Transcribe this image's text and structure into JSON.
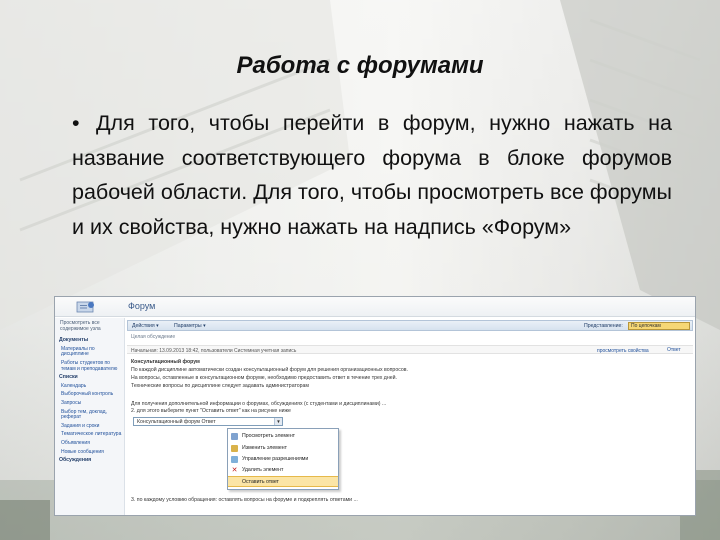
{
  "slide": {
    "title": "Работа с форумами",
    "bullet": "•",
    "text": "Для того, чтобы перейти в форум, нужно нажать на название соответствующего форума в блоке форумов рабочей области. Для того, чтобы просмотреть все форумы и их свойства, нужно нажать на надпись «Форум»"
  },
  "screenshot": {
    "page_title": "Форум",
    "left_nav": {
      "top_items": [
        "Просмотреть все содержимое узла"
      ],
      "sections": [
        {
          "heading": "Документы",
          "items": [
            "Материалы по дисциплине",
            "Работы студентов по темам и преподавателю"
          ]
        },
        {
          "heading": "Списки",
          "items": [
            "Календарь",
            "Выборочный контроль",
            "Запросы",
            "Выбор тем, доклад, реферат",
            "Задания и сроки",
            "Тематическое литература",
            "Объявления",
            "Новые сообщения"
          ]
        },
        {
          "heading": "Обсуждения",
          "items": []
        }
      ]
    },
    "toolbar": {
      "actions_label": "Действия ▾",
      "settings_label": "Параметры ▾",
      "view_label": "Представление:",
      "view_value": "По цепочкам"
    },
    "breadcrumb": "Целая обсуждение",
    "info_bar": {
      "left": "Начальная: 13.09.2013 18:42, пользователи Системная учетная запись",
      "right": "просмотреть свойства",
      "reply": "Ответ"
    },
    "body_lines": [
      "Консультационный форум",
      "По каждой дисциплине автоматически создан консультационный форум для решения организационных вопросов.",
      "На вопросы, оставленные в консультационном форуме, необходимо предоставить ответ в течение трех дней.",
      "Технические вопросы по дисциплине следует задавать администраторам",
      "Для получения дополнительной информации о форумах, обсуждениях (с студентами и дисциплинами) ...",
      "2. для этого выберите пункт \"Оставить ответ\" как на рисунке ниже"
    ],
    "inline_select": "Консультационный форум Ответ",
    "context_menu": {
      "items": [
        "Просмотреть элемент",
        "Изменить элемент",
        "Управление разрешениями",
        "Удалить элемент",
        "Оставить ответ"
      ],
      "selected_index": 4
    },
    "footer_line": "3. по каждому условию обращения: оставлять вопросы на форуме и подкреплять ответами ..."
  },
  "colors": {
    "title": "#111111",
    "link": "#1f4f9a",
    "menu_highlight": "#fbe5a6",
    "view_select": "#f6d775"
  }
}
